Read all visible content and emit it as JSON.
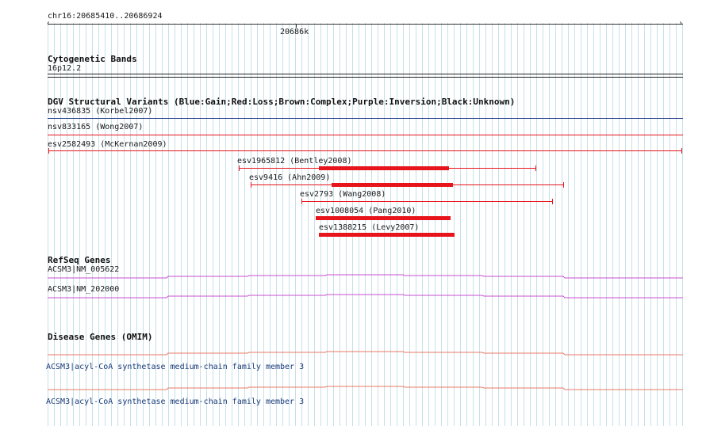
{
  "ruler": {
    "region": "chr16:20685410..20686924",
    "tick_label": "20686k"
  },
  "cytobands": {
    "title": "Cytogenetic Bands",
    "band": "16p12.2"
  },
  "dgv": {
    "title": "DGV Structural Variants (Blue:Gain;Red:Loss;Brown:Complex;Purple:Inversion;Black:Unknown)",
    "colors": {
      "gain": "#1f3c88",
      "loss": "#e8141b"
    },
    "variants": [
      {
        "label": "nsv436835 (Korbel2007)",
        "type": "gain"
      },
      {
        "label": "nsv833165 (Wong2007)",
        "type": "loss"
      },
      {
        "label": "esv2582493 (McKernan2009)",
        "type": "loss"
      },
      {
        "label": "esv1965812 (Bentley2008)",
        "type": "loss"
      },
      {
        "label": "esv9416 (Ahn2009)",
        "type": "loss"
      },
      {
        "label": "esv2793 (Wang2008)",
        "type": "loss"
      },
      {
        "label": "esv1008054 (Pang2010)",
        "type": "loss"
      },
      {
        "label": "esv1388215 (Levy2007)",
        "type": "loss"
      }
    ]
  },
  "refseq": {
    "title": "RefSeq Genes",
    "color": "#c84fcf",
    "genes": [
      {
        "label": "ACSM3|NM_005622"
      },
      {
        "label": "ACSM3|NM_202000"
      }
    ]
  },
  "omim": {
    "title": "Disease Genes (OMIM)",
    "color": "#e87a64",
    "genes": [
      {
        "label": "ACSM3|acyl-CoA synthetase medium-chain family member 3"
      },
      {
        "label": "ACSM3|acyl-CoA synthetase medium-chain family member 3"
      }
    ]
  }
}
